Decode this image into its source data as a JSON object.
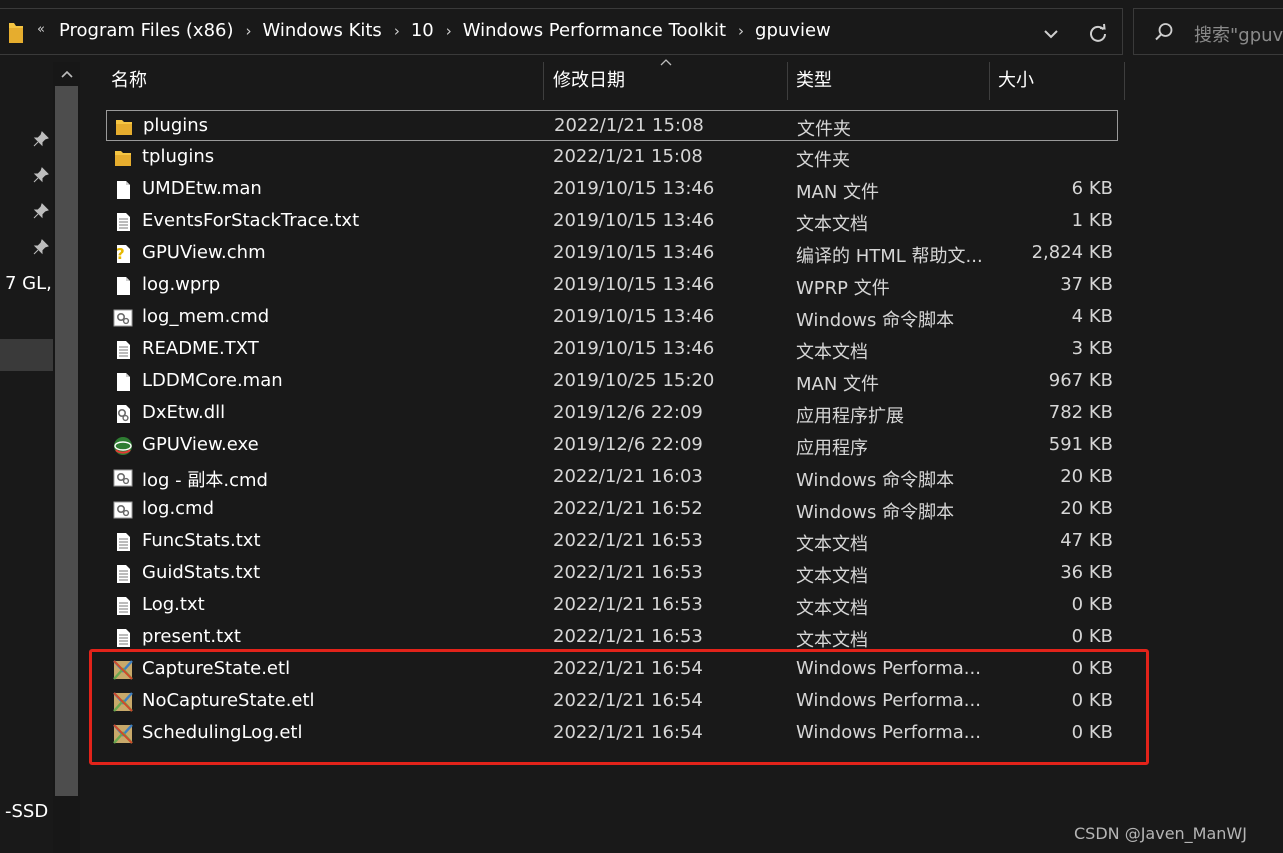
{
  "address_bar": {
    "overflow_glyph": "«",
    "breadcrumbs": [
      "Program Files (x86)",
      "Windows Kits",
      "10",
      "Windows Performance Toolkit",
      "gpuview"
    ],
    "separator": "›"
  },
  "search": {
    "placeholder": "搜索\"gpuview\""
  },
  "nav_pane": {
    "text_fragments": [
      "7 GL,",
      "-SSD ("
    ]
  },
  "columns": {
    "name": "名称",
    "date": "修改日期",
    "type": "类型",
    "size": "大小"
  },
  "files": [
    {
      "name": "plugins",
      "date": "2022/1/21 15:08",
      "type": "文件夹",
      "size": "",
      "icon": "folder-icon"
    },
    {
      "name": "tplugins",
      "date": "2022/1/21 15:08",
      "type": "文件夹",
      "size": "",
      "icon": "folder-icon"
    },
    {
      "name": "UMDEtw.man",
      "date": "2019/10/15 13:46",
      "type": "MAN 文件",
      "size": "6 KB",
      "icon": "blank-file-icon"
    },
    {
      "name": "EventsForStackTrace.txt",
      "date": "2019/10/15 13:46",
      "type": "文本文档",
      "size": "1 KB",
      "icon": "text-file-icon"
    },
    {
      "name": "GPUView.chm",
      "date": "2019/10/15 13:46",
      "type": "编译的 HTML 帮助文...",
      "size": "2,824 KB",
      "icon": "chm-help-icon"
    },
    {
      "name": "log.wprp",
      "date": "2019/10/15 13:46",
      "type": "WPRP 文件",
      "size": "37 KB",
      "icon": "blank-file-icon"
    },
    {
      "name": "log_mem.cmd",
      "date": "2019/10/15 13:46",
      "type": "Windows 命令脚本",
      "size": "4 KB",
      "icon": "cmd-script-icon"
    },
    {
      "name": "README.TXT",
      "date": "2019/10/15 13:46",
      "type": "文本文档",
      "size": "3 KB",
      "icon": "text-file-icon"
    },
    {
      "name": "LDDMCore.man",
      "date": "2019/10/25 15:20",
      "type": "MAN 文件",
      "size": "967 KB",
      "icon": "blank-file-icon"
    },
    {
      "name": "DxEtw.dll",
      "date": "2019/12/6 22:09",
      "type": "应用程序扩展",
      "size": "782 KB",
      "icon": "dll-gear-icon"
    },
    {
      "name": "GPUView.exe",
      "date": "2019/12/6 22:09",
      "type": "应用程序",
      "size": "591 KB",
      "icon": "gpuview-app-icon"
    },
    {
      "name": "log - 副本.cmd",
      "date": "2022/1/21 16:03",
      "type": "Windows 命令脚本",
      "size": "20 KB",
      "icon": "cmd-script-icon"
    },
    {
      "name": "log.cmd",
      "date": "2022/1/21 16:52",
      "type": "Windows 命令脚本",
      "size": "20 KB",
      "icon": "cmd-script-icon"
    },
    {
      "name": "FuncStats.txt",
      "date": "2022/1/21 16:53",
      "type": "文本文档",
      "size": "47 KB",
      "icon": "text-file-icon"
    },
    {
      "name": "GuidStats.txt",
      "date": "2022/1/21 16:53",
      "type": "文本文档",
      "size": "36 KB",
      "icon": "text-file-icon"
    },
    {
      "name": "Log.txt",
      "date": "2022/1/21 16:53",
      "type": "文本文档",
      "size": "0 KB",
      "icon": "text-file-icon"
    },
    {
      "name": "present.txt",
      "date": "2022/1/21 16:53",
      "type": "文本文档",
      "size": "0 KB",
      "icon": "text-file-icon"
    },
    {
      "name": "CaptureState.etl",
      "date": "2022/1/21 16:54",
      "type": "Windows Performa...",
      "size": "0 KB",
      "icon": "etl-trace-icon"
    },
    {
      "name": "NoCaptureState.etl",
      "date": "2022/1/21 16:54",
      "type": "Windows Performa...",
      "size": "0 KB",
      "icon": "etl-trace-icon"
    },
    {
      "name": "SchedulingLog.etl",
      "date": "2022/1/21 16:54",
      "type": "Windows Performa...",
      "size": "0 KB",
      "icon": "etl-trace-icon"
    }
  ],
  "focused_row": 0,
  "highlight": {
    "color": "#e2231a",
    "rows": [
      17,
      18,
      19
    ]
  },
  "watermark": "CSDN @Javen_ManWJ",
  "colors": {
    "background": "#191919",
    "text": "#ffffff",
    "secondary_text": "#d6d6d6",
    "divider": "#3e3e3e",
    "folder": "#f5c542",
    "annotation": "#e2231a"
  }
}
